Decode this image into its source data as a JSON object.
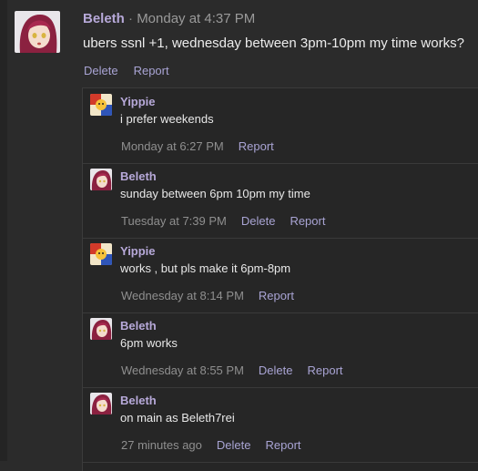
{
  "post": {
    "author": "Beleth",
    "separator": "·",
    "timestamp": "Monday at 4:37 PM",
    "text": "ubers ssnl +1, wednesday between 3pm-10pm my time works?",
    "actions": {
      "delete": "Delete",
      "report": "Report"
    }
  },
  "replies": [
    {
      "author": "Yippie",
      "text": "i prefer weekends",
      "time": "Monday at 6:27 PM",
      "delete": "",
      "report": "Report",
      "avatar": "yippie-avatar"
    },
    {
      "author": "Beleth",
      "text": "sunday between 6pm 10pm my time",
      "time": "Tuesday at 7:39 PM",
      "delete": "Delete",
      "report": "Report",
      "avatar": "beleth-avatar"
    },
    {
      "author": "Yippie",
      "text": "works , but pls make it 6pm-8pm",
      "time": "Wednesday at 8:14 PM",
      "delete": "",
      "report": "Report",
      "avatar": "yippie-avatar"
    },
    {
      "author": "Beleth",
      "text": "6pm works",
      "time": "Wednesday at 8:55 PM",
      "delete": "Delete",
      "report": "Report",
      "avatar": "beleth-avatar"
    },
    {
      "author": "Beleth",
      "text": "on main as Beleth7rei",
      "time": "27 minutes ago",
      "delete": "Delete",
      "report": "Report",
      "avatar": "beleth-avatar"
    }
  ],
  "colors": {
    "background": "#2b2b2b",
    "author": "#b7a9d9",
    "link": "#a9a4d4",
    "muted": "#8f8f8f"
  }
}
